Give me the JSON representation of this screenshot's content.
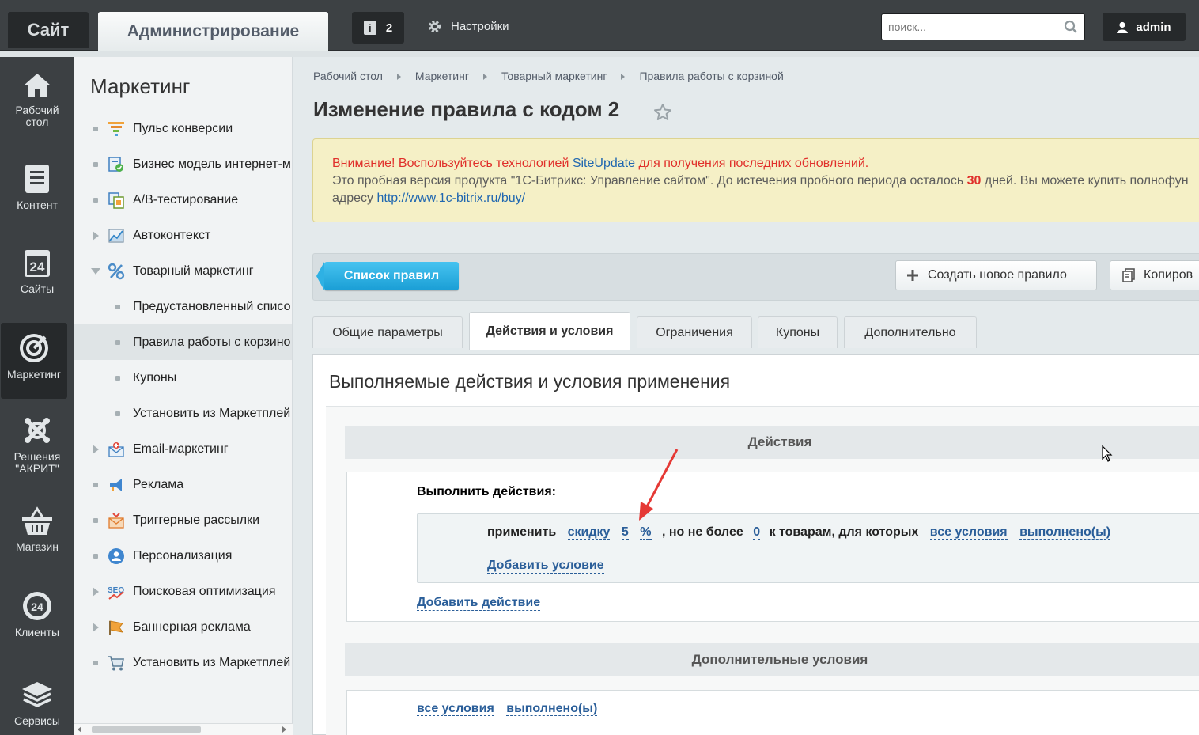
{
  "topbar": {
    "site_tab": "Сайт",
    "admin_tab": "Администрирование",
    "notifications_count": "2",
    "notifications_icon": "info-icon",
    "settings_label": "Настройки",
    "search_placeholder": "поиск...",
    "user_label": "admin"
  },
  "iconbar": {
    "items": [
      {
        "label_1": "Рабочий",
        "label_2": "стол",
        "icon": "home-icon"
      },
      {
        "label_1": "Контент",
        "label_2": "",
        "icon": "document-icon"
      },
      {
        "label_1": "Сайты",
        "label_2": "",
        "icon": "calendar-24-icon"
      },
      {
        "label_1": "Маркетинг",
        "label_2": "",
        "icon": "target-icon",
        "active": true
      },
      {
        "label_1": "Решения",
        "label_2": "\"АКРИТ\"",
        "icon": "puzzle-icon"
      },
      {
        "label_1": "Магазин",
        "label_2": "",
        "icon": "basket-icon"
      },
      {
        "label_1": "Клиенты",
        "label_2": "",
        "icon": "clients-24-icon"
      },
      {
        "label_1": "Сервисы",
        "label_2": "",
        "icon": "layers-icon"
      }
    ]
  },
  "menu": {
    "title": "Маркетинг",
    "items": [
      {
        "label": "Пульс конверсии",
        "mark": "dot",
        "icon": "funnel-icon"
      },
      {
        "label": "Бизнес модель интернет-м",
        "mark": "dot",
        "icon": "business-model-icon"
      },
      {
        "label": "A/B-тестирование",
        "mark": "dot",
        "icon": "ab-test-icon"
      },
      {
        "label": "Автоконтекст",
        "mark": "arrow-right",
        "icon": "chart-icon"
      },
      {
        "label": "Товарный маркетинг",
        "mark": "arrow-down",
        "icon": "percent-icon"
      },
      {
        "label": "Предустановленный списо",
        "mark": "dot",
        "sub": true
      },
      {
        "label": "Правила работы с корзино",
        "mark": "dot",
        "sub": true,
        "selected": true
      },
      {
        "label": "Купоны",
        "mark": "dot",
        "sub": true
      },
      {
        "label": "Установить из Маркетплей",
        "mark": "dot",
        "sub": true
      },
      {
        "label": "Email-маркетинг",
        "mark": "arrow-right",
        "icon": "email-icon"
      },
      {
        "label": "Реклама",
        "mark": "dot",
        "icon": "megaphone-icon"
      },
      {
        "label": "Триггерные рассылки",
        "mark": "dot",
        "icon": "trigger-mail-icon"
      },
      {
        "label": "Персонализация",
        "mark": "dot",
        "icon": "person-icon"
      },
      {
        "label": "Поисковая оптимизация",
        "mark": "arrow-right",
        "icon": "seo-icon"
      },
      {
        "label": "Баннерная реклама",
        "mark": "arrow-right",
        "icon": "banner-flag-icon"
      },
      {
        "label": "Установить из Маркетплей",
        "mark": "dot",
        "icon": "cart-icon"
      }
    ]
  },
  "breadcrumb": [
    "Рабочий стол",
    "Маркетинг",
    "Товарный маркетинг",
    "Правила работы с корзиной"
  ],
  "page_title": "Изменение правила с кодом 2",
  "warning": {
    "line1_prefix": "Внимание! Воспользуйтесь технологией ",
    "line1_link": "SiteUpdate",
    "line1_suffix": " для получения последних обновлений.",
    "line2_prefix": "Это пробная версия продукта \"1С-Битрикс: Управление сайтом\". До истечения пробного периода осталось ",
    "line2_days": "30",
    "line2_suffix": " дней. Вы можете купить полнофун",
    "line3_prefix": "адресу ",
    "line3_link": "http://www.1c-bitrix.ru/buy/"
  },
  "toolbar": {
    "list_button": "Список правил",
    "new_button": "Создать новое правило",
    "copy_button": "Копиров"
  },
  "tabs": [
    "Общие параметры",
    "Действия и условия",
    "Ограничения",
    "Купоны",
    "Дополнительно"
  ],
  "active_tab": "Действия и условия",
  "panel": {
    "heading": "Выполняемые действия и условия применения",
    "actions_header": "Действия",
    "do_actions_title": "Выполнить действия:",
    "action_row": {
      "apply": "применить",
      "discount": "скидку",
      "amount": "5",
      "unit": "%",
      "not_more": ", но не более",
      "limit": "0",
      "to_goods": "к товарам, для которых",
      "all_conditions": "все условия",
      "fulfilled": "выполнено(ы)"
    },
    "add_condition": "Добавить условие",
    "add_action": "Добавить действие",
    "extra_header": "Дополнительные условия",
    "extra_all_conditions": "все условия",
    "extra_fulfilled": "выполнено(ы)"
  },
  "colors": {
    "accent": "#1a9ed5",
    "link": "#2a5e99",
    "warning_red": "#e0302b",
    "topbar": "#3d4144"
  }
}
